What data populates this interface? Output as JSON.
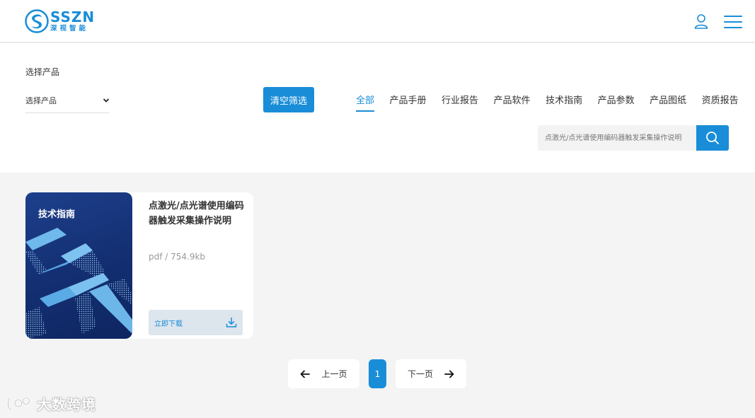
{
  "header": {
    "logo_en": "SSZN",
    "logo_cn": "深视智能",
    "icons": [
      "user-icon",
      "menu-icon"
    ]
  },
  "filter": {
    "label": "选择产品",
    "select_value": "选择产品",
    "clear_label": "清空筛选",
    "tabs": [
      {
        "label": "全部",
        "active": true
      },
      {
        "label": "产品手册",
        "active": false
      },
      {
        "label": "行业报告",
        "active": false
      },
      {
        "label": "产品软件",
        "active": false
      },
      {
        "label": "技术指南",
        "active": false
      },
      {
        "label": "产品参数",
        "active": false
      },
      {
        "label": "产品图纸",
        "active": false
      },
      {
        "label": "资质报告",
        "active": false
      }
    ],
    "search_placeholder": "点激光/点光谱使用编码器触发采集操作说明",
    "search_icon": "search-icon"
  },
  "card": {
    "cover_title": "技术指南",
    "title": "点激光/点光谱使用编码器触发采集操作说明",
    "meta": "pdf / 754.9kb",
    "download_label": "立即下载",
    "download_icon": "download-icon"
  },
  "pagination": {
    "prev_label": "上一页",
    "current": "1",
    "next_label": "下一页"
  },
  "watermark": {
    "text": "大数跨境"
  },
  "colors": {
    "accent": "#1a8dd8",
    "page_bg": "#f3f4f3",
    "cover_dark": "#143073"
  }
}
